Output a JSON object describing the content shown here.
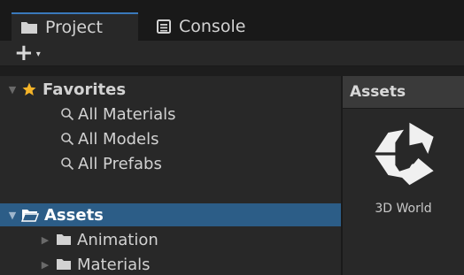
{
  "tabs": [
    {
      "label": "Project",
      "icon": "folder-icon",
      "active": true
    },
    {
      "label": "Console",
      "icon": "console-icon",
      "active": false
    }
  ],
  "toolbar": {
    "add_label": "+",
    "add_caret": "▾"
  },
  "tree": {
    "favorites": {
      "label": "Favorites",
      "items": [
        "All Materials",
        "All Models",
        "All Prefabs"
      ]
    },
    "assets": {
      "label": "Assets",
      "children": [
        "Animation",
        "Materials"
      ]
    }
  },
  "right_panel": {
    "header": "Assets",
    "items": [
      {
        "label": "3D World",
        "icon": "unity-logo-icon"
      }
    ]
  },
  "colors": {
    "accent": "#3a79bb",
    "selection": "#2c5d87",
    "star": "#f5b428"
  }
}
